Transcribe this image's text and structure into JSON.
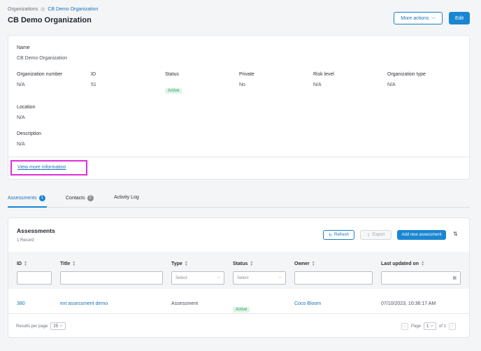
{
  "breadcrumb": {
    "root": "Organizations",
    "current": "CB Demo Organization"
  },
  "page_title": "CB Demo Organization",
  "header_actions": {
    "more_actions": "More actions",
    "edit": "Edit"
  },
  "info": {
    "name_label": "Name",
    "name_value": "CB Demo Organization",
    "fields": [
      {
        "label": "Organization number",
        "value": "N/A"
      },
      {
        "label": "ID",
        "value": "51"
      },
      {
        "label": "Status",
        "value": "Active"
      },
      {
        "label": "Private",
        "value": "No"
      },
      {
        "label": "Risk level",
        "value": "N/A"
      },
      {
        "label": "Organization type",
        "value": "N/A"
      }
    ],
    "location_label": "Location",
    "location_value": "N/A",
    "description_label": "Description",
    "description_value": "N/A",
    "view_more": "View more information"
  },
  "tabs": [
    {
      "label": "Assessments",
      "count": "1"
    },
    {
      "label": "Contacts",
      "count": "2"
    },
    {
      "label": "Activity Log"
    }
  ],
  "assessments": {
    "title": "Assessments",
    "records": "1 Record",
    "refresh": "Refresh",
    "export": "Export",
    "add": "Add new assessment",
    "columns": [
      "ID",
      "Title",
      "Type",
      "Status",
      "Owner",
      "Last updated on"
    ],
    "filter_placeholders": {
      "type": "Select",
      "status": "Select"
    },
    "rows": [
      {
        "id": "380",
        "title": "ext assessment demo",
        "type": "Assessment",
        "status": "Active",
        "owner": "Coco Bloom",
        "updated": "07/10/2023, 10:36:17 AM"
      }
    ],
    "results_per_page_label": "Results per page",
    "results_per_page": "25",
    "page_label": "Page",
    "page": "1",
    "of_label": "of 1"
  },
  "colors": {
    "accent": "#1a86d1",
    "highlight": "#e02fd6",
    "active_badge": "#2e9e5b"
  }
}
